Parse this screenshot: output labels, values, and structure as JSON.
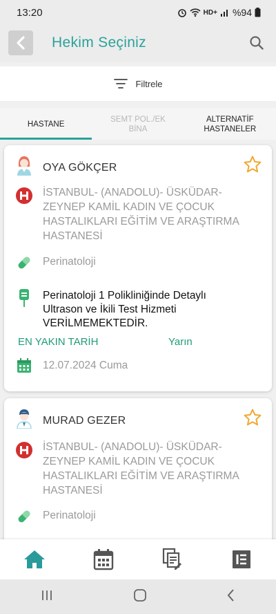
{
  "status_bar": {
    "time": "13:20",
    "battery": "%94"
  },
  "appbar": {
    "title": "Hekim Seçiniz"
  },
  "filter": {
    "label": "Filtrele"
  },
  "tabs": [
    {
      "label": "HASTANE",
      "active": true
    },
    {
      "label": "SEMT POL./EK BİNA",
      "active": false
    },
    {
      "label": "ALTERNATİF HASTANELER",
      "active": false
    }
  ],
  "doctors": [
    {
      "name": "OYA GÖKÇER",
      "hospital": "İSTANBUL- (ANADOLU)- ÜSKÜDAR- ZEYNEP KAMİL KADIN VE ÇOCUK HASTALIKLARI EĞİTİM VE ARAŞTIRMA HASTANESİ",
      "department": "Perinatoloji",
      "notice": "Perinatoloji 1 Polikliniğinde Detaylı Ultrason ve İkili Test Hizmeti VERİLMEMEKTEDİR.",
      "earliest_label": "EN YAKIN TARİH",
      "earliest_value": "Yarın",
      "date": "12.07.2024 Cuma"
    },
    {
      "name": "MURAD GEZER",
      "hospital": "İSTANBUL- (ANADOLU)- ÜSKÜDAR- ZEYNEP KAMİL KADIN VE ÇOCUK HASTALIKLARI EĞİTİM VE ARAŞTIRMA HASTANESİ",
      "department": "Perinatoloji"
    }
  ],
  "colors": {
    "accent": "#2aa29a",
    "green": "#1f9c76",
    "star": "#f0a830",
    "hospital_red": "#d32f2f"
  }
}
